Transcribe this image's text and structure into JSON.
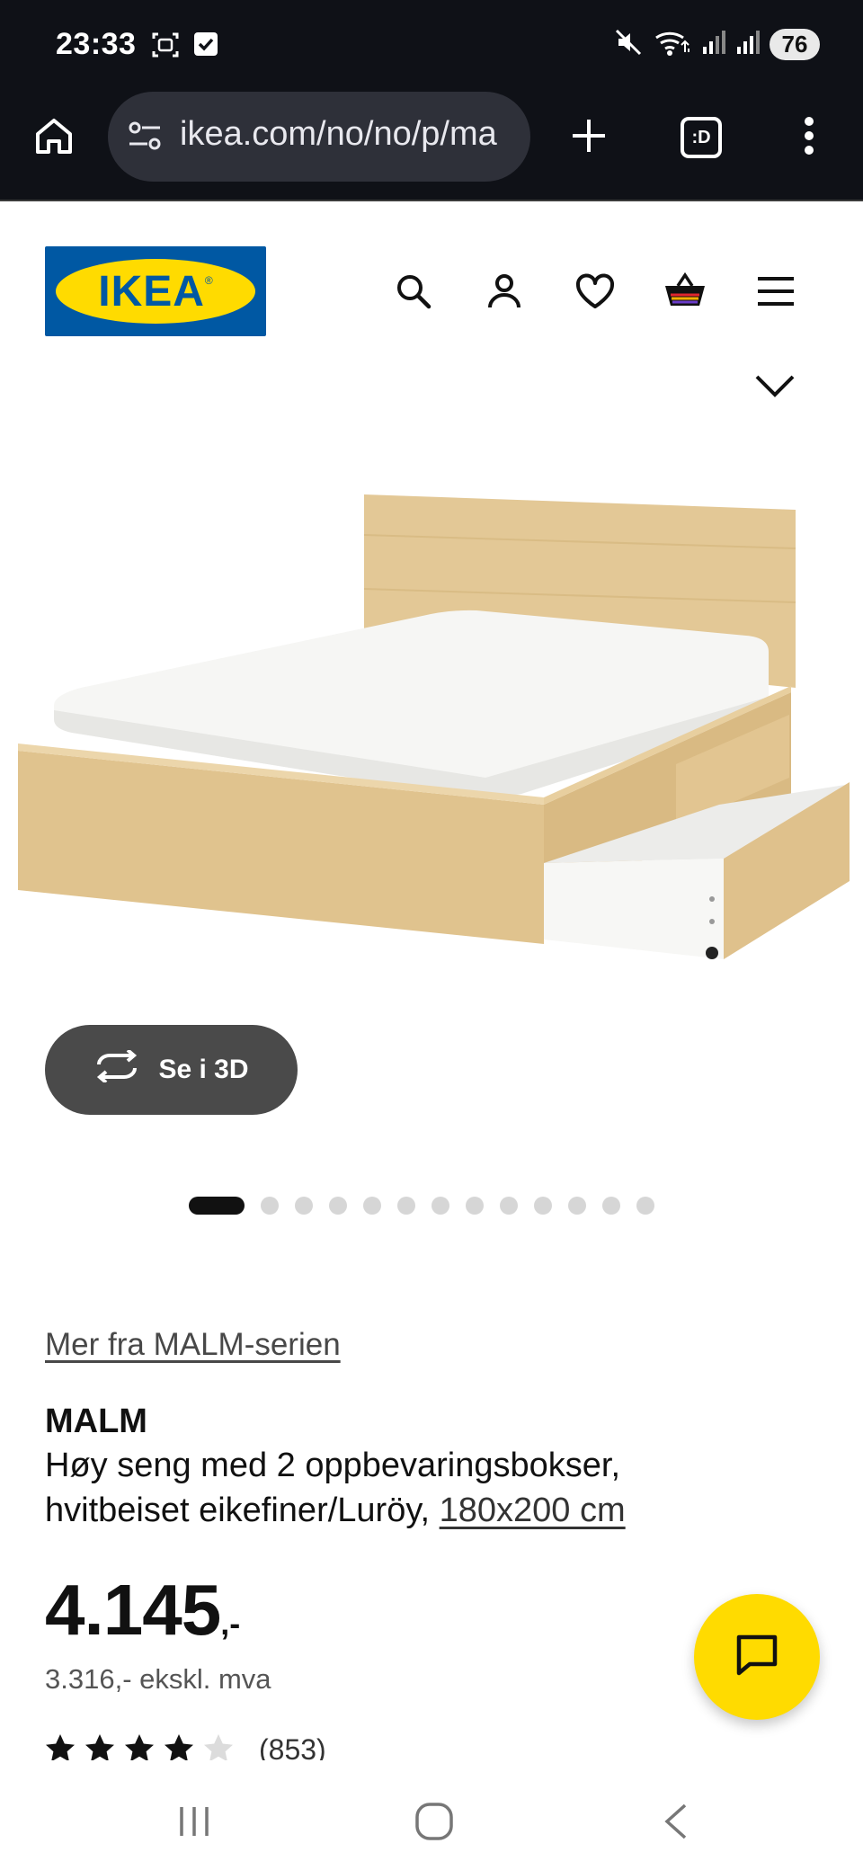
{
  "status_bar": {
    "time": "23:33",
    "battery": "76",
    "icons": [
      "screenshot-icon",
      "checkbox-notification-icon",
      "mute-icon",
      "wifi-icon",
      "signal-icon",
      "signal-icon-2"
    ]
  },
  "browser": {
    "url": "ikea.com/no/no/p/ma",
    "tab_count_label": ":D",
    "icons": [
      "home-icon",
      "site-settings-icon",
      "new-tab-plus-icon",
      "tab-switcher-icon",
      "more-vert-icon"
    ]
  },
  "header": {
    "logo_text": "IKEA",
    "logo_registered": "®",
    "icons": [
      "search-icon",
      "account-icon",
      "heart-icon",
      "cart-icon",
      "menu-icon"
    ]
  },
  "gallery": {
    "view_3d_label": "Se i 3D",
    "dot_count": 14,
    "active_dot": 0
  },
  "product": {
    "series_link": "Mer fra MALM-serien",
    "name": "MALM",
    "description": "Høy seng med 2 oppbevaringsbokser, hvitbeiset eikefiner/Luröy,",
    "size_link": "180x200 cm",
    "price_main": "4.145",
    "price_suffix": ",-",
    "price_ex_vat": "3.316,- ekskl. mva",
    "rating_count": "(853)",
    "rating_stars": 4.5
  },
  "colors": {
    "ikea_blue": "#0058a3",
    "ikea_yellow": "#ffdb00",
    "chrome_dark": "#0f1117",
    "button_3d": "#4a4a4a"
  }
}
